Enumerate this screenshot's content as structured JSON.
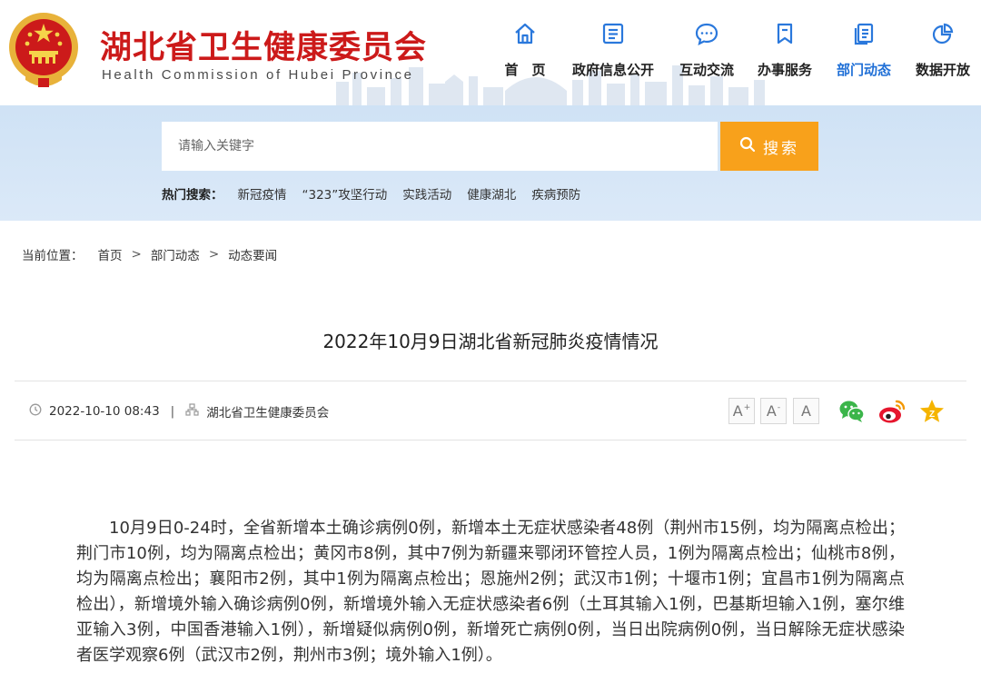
{
  "site": {
    "title": "湖北省卫生健康委员会",
    "subtitle": "Health Commission of Hubei Province",
    "brand_color": "#cc1a1a"
  },
  "nav": {
    "active_color": "#1f6fd6",
    "items": [
      {
        "label": "首　页",
        "icon": "home-icon"
      },
      {
        "label": "政府信息公开",
        "icon": "list-icon"
      },
      {
        "label": "互动交流",
        "icon": "chat-icon"
      },
      {
        "label": "办事服务",
        "icon": "bookmark-icon"
      },
      {
        "label": "部门动态",
        "icon": "document-icon",
        "active": true
      },
      {
        "label": "数据开放",
        "icon": "pie-chart-icon"
      }
    ]
  },
  "search": {
    "placeholder": "请输入关键字",
    "button_label": "搜索",
    "button_color": "#f8a11b",
    "hot_label": "热门搜索：",
    "hot_items": [
      "新冠疫情",
      "“323”攻坚行动",
      "实践活动",
      "健康湖北",
      "疾病预防"
    ]
  },
  "breadcrumb": {
    "label": "当前位置：",
    "items": [
      "首页",
      "部门动态",
      "动态要闻"
    ],
    "separator": ">"
  },
  "article": {
    "title": "2022年10月9日湖北省新冠肺炎疫情情况",
    "date": "2022-10-10 08:43",
    "meta_separator": "|",
    "source": "湖北省卫生健康委员会",
    "font_controls": [
      "A",
      "A",
      "A"
    ],
    "body": "10月9日0-24时，全省新增本土确诊病例0例，新增本土无症状感染者48例（荆州市15例，均为隔离点检出；荆门市10例，均为隔离点检出；黄冈市8例，其中7例为新疆来鄂闭环管控人员，1例为隔离点检出；仙桃市8例，均为隔离点检出；襄阳市2例，其中1例为隔离点检出；恩施州2例；武汉市1例；十堰市1例；宜昌市1例为隔离点检出），新增境外输入确诊病例0例，新增境外输入无症状感染者6例（土耳其输入1例，巴基斯坦输入1例，塞尔维亚输入3例，中国香港输入1例），新增疑似病例0例，新增死亡病例0例，当日出院病例0例，当日解除无症状感染者医学观察6例（武汉市2例，荆州市3例；境外输入1例）。"
  },
  "share": {
    "icons": [
      "wechat-icon",
      "weibo-icon",
      "favorite-icon"
    ]
  }
}
